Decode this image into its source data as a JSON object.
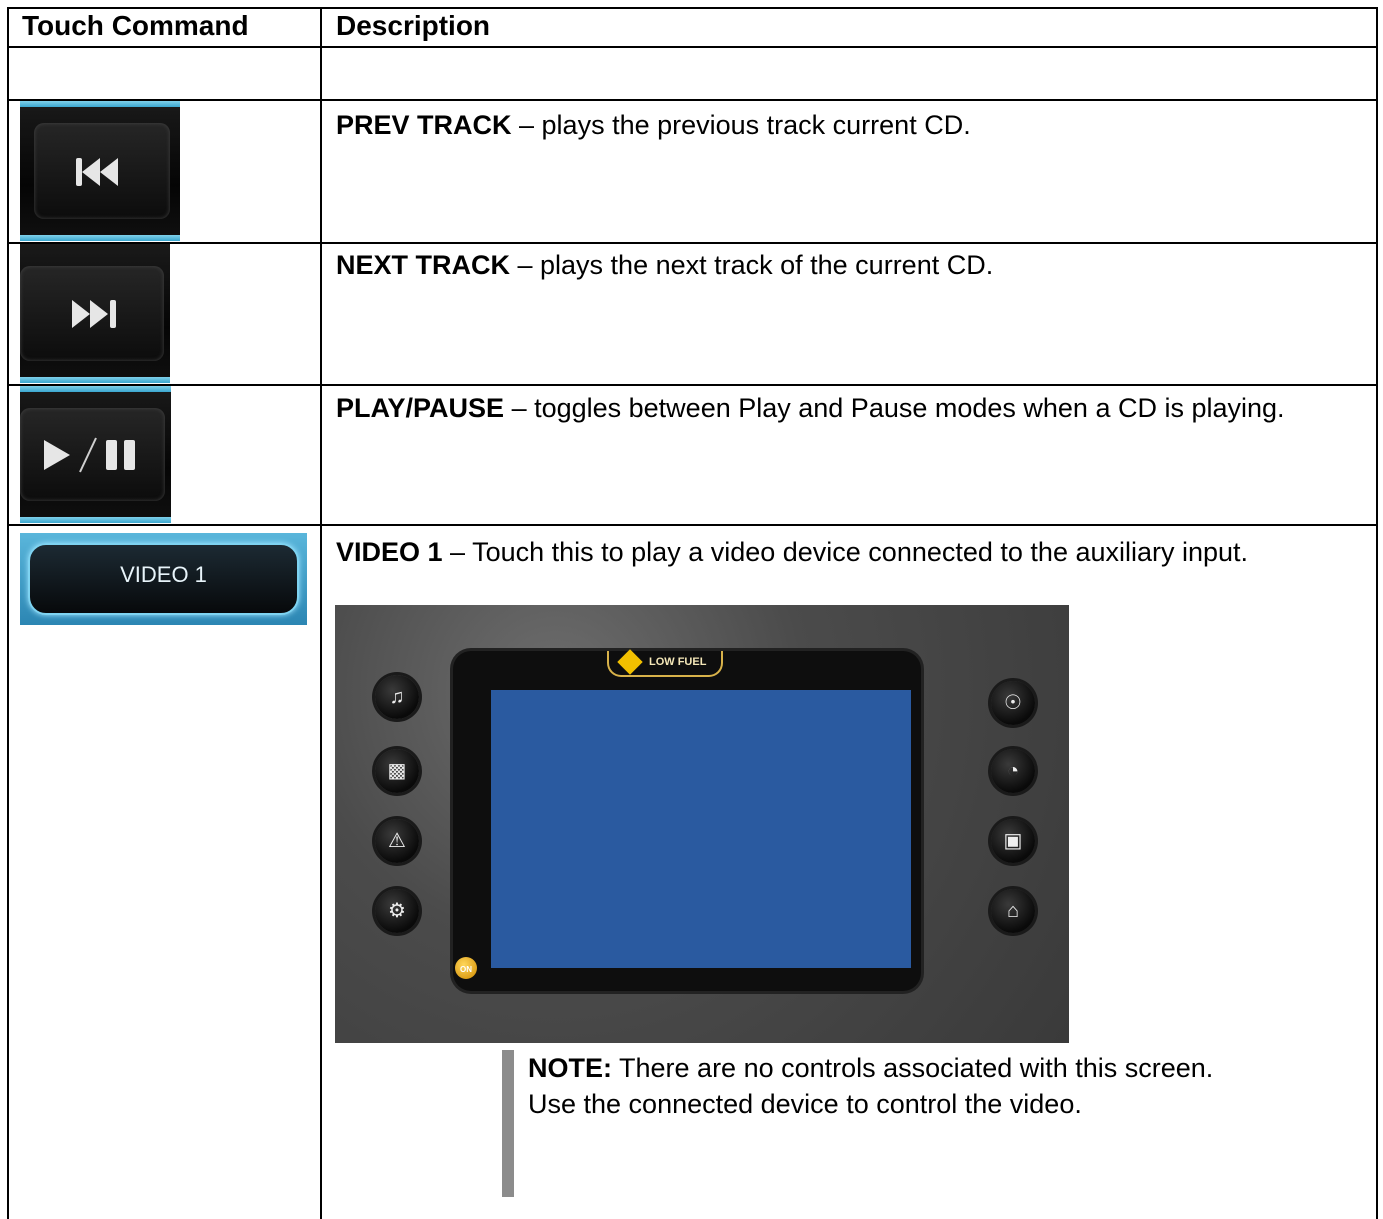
{
  "table": {
    "headers": [
      "Touch Command",
      "Description"
    ],
    "rows": [
      {
        "button_icon": "prev-track-icon",
        "title": "PREV TRACK",
        "text": " – plays the previous track current CD."
      },
      {
        "button_icon": "next-track-icon",
        "title": "NEXT TRACK",
        "text": " – plays the next track of the current CD."
      },
      {
        "button_icon": "play-pause-icon",
        "title": "PLAY/PAUSE",
        "text": " – toggles between Play and Pause modes when a CD is playing."
      },
      {
        "button_label": "VIDEO 1",
        "title": "VIDEO 1",
        "text": " – Touch this to play a video device connected to the auxiliary input."
      }
    ]
  },
  "screen": {
    "banner": "LOW FUEL",
    "power_label": "ON",
    "display_color": "#2a5aa0",
    "left_icons": [
      "music-note-icon",
      "camera-icon",
      "warning-icon",
      "gear-icon"
    ],
    "right_icons": [
      "globe-icon",
      "gauge-icon",
      "engine-icon",
      "home-icon"
    ]
  },
  "note": {
    "label": "NOTE:",
    "text": " There are no controls associated with this screen. Use the connected device to control the video."
  }
}
